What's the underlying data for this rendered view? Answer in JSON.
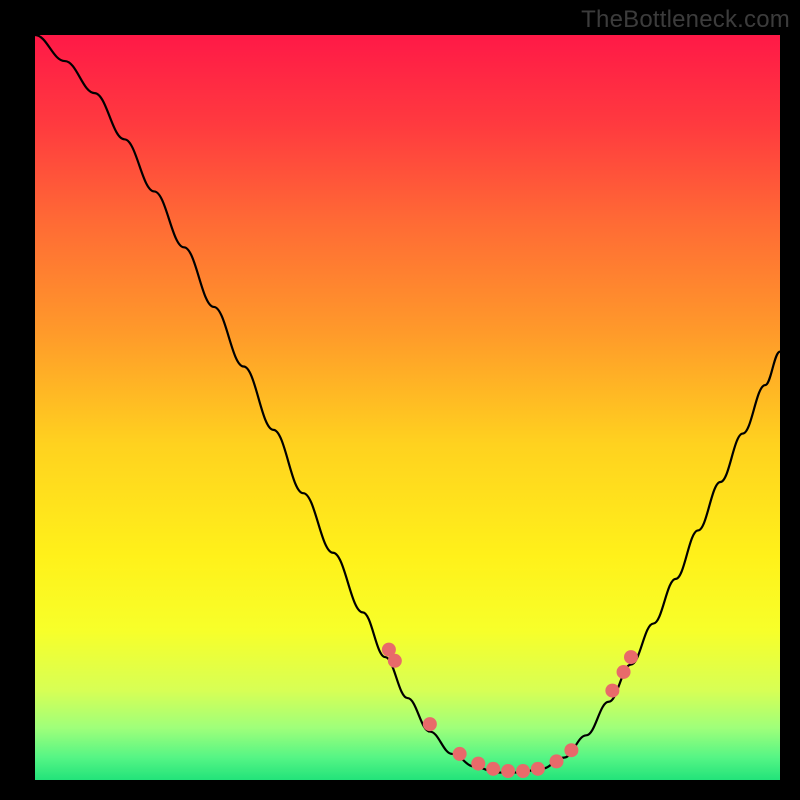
{
  "watermark": "TheBottleneck.com",
  "colors": {
    "background_black": "#000000",
    "curve_stroke": "#000000",
    "marker_fill": "#e86a6a",
    "marker_stroke": "#c74b4b"
  },
  "chart_data": {
    "type": "line",
    "title": "",
    "xlabel": "",
    "ylabel": "",
    "xlim": [
      0,
      100
    ],
    "ylim": [
      0,
      100
    ],
    "gradient_stops": [
      {
        "offset": 0.0,
        "color": "#ff1947"
      },
      {
        "offset": 0.12,
        "color": "#ff3a3f"
      },
      {
        "offset": 0.25,
        "color": "#ff6a35"
      },
      {
        "offset": 0.4,
        "color": "#ff9a2a"
      },
      {
        "offset": 0.55,
        "color": "#ffd21f"
      },
      {
        "offset": 0.7,
        "color": "#fff11a"
      },
      {
        "offset": 0.8,
        "color": "#f7ff2a"
      },
      {
        "offset": 0.88,
        "color": "#d7ff55"
      },
      {
        "offset": 0.93,
        "color": "#9fff7a"
      },
      {
        "offset": 0.97,
        "color": "#55f585"
      },
      {
        "offset": 1.0,
        "color": "#22e37a"
      }
    ],
    "curve_normalized": [
      {
        "x": 0.0,
        "y": 1.0
      },
      {
        "x": 0.04,
        "y": 0.965
      },
      {
        "x": 0.08,
        "y": 0.922
      },
      {
        "x": 0.12,
        "y": 0.86
      },
      {
        "x": 0.16,
        "y": 0.79
      },
      {
        "x": 0.2,
        "y": 0.715
      },
      {
        "x": 0.24,
        "y": 0.635
      },
      {
        "x": 0.28,
        "y": 0.555
      },
      {
        "x": 0.32,
        "y": 0.47
      },
      {
        "x": 0.36,
        "y": 0.385
      },
      {
        "x": 0.4,
        "y": 0.305
      },
      {
        "x": 0.44,
        "y": 0.225
      },
      {
        "x": 0.47,
        "y": 0.165
      },
      {
        "x": 0.5,
        "y": 0.11
      },
      {
        "x": 0.53,
        "y": 0.065
      },
      {
        "x": 0.56,
        "y": 0.035
      },
      {
        "x": 0.59,
        "y": 0.018
      },
      {
        "x": 0.62,
        "y": 0.01
      },
      {
        "x": 0.65,
        "y": 0.01
      },
      {
        "x": 0.68,
        "y": 0.015
      },
      {
        "x": 0.71,
        "y": 0.03
      },
      {
        "x": 0.74,
        "y": 0.06
      },
      {
        "x": 0.77,
        "y": 0.105
      },
      {
        "x": 0.8,
        "y": 0.155
      },
      {
        "x": 0.83,
        "y": 0.21
      },
      {
        "x": 0.86,
        "y": 0.27
      },
      {
        "x": 0.89,
        "y": 0.335
      },
      {
        "x": 0.92,
        "y": 0.4
      },
      {
        "x": 0.95,
        "y": 0.465
      },
      {
        "x": 0.98,
        "y": 0.53
      },
      {
        "x": 1.0,
        "y": 0.575
      }
    ],
    "markers_normalized": [
      {
        "x": 0.475,
        "y": 0.175
      },
      {
        "x": 0.483,
        "y": 0.16
      },
      {
        "x": 0.53,
        "y": 0.075
      },
      {
        "x": 0.57,
        "y": 0.035
      },
      {
        "x": 0.595,
        "y": 0.022
      },
      {
        "x": 0.615,
        "y": 0.015
      },
      {
        "x": 0.635,
        "y": 0.012
      },
      {
        "x": 0.655,
        "y": 0.012
      },
      {
        "x": 0.675,
        "y": 0.015
      },
      {
        "x": 0.7,
        "y": 0.025
      },
      {
        "x": 0.72,
        "y": 0.04
      },
      {
        "x": 0.775,
        "y": 0.12
      },
      {
        "x": 0.79,
        "y": 0.145
      },
      {
        "x": 0.8,
        "y": 0.165
      }
    ]
  }
}
